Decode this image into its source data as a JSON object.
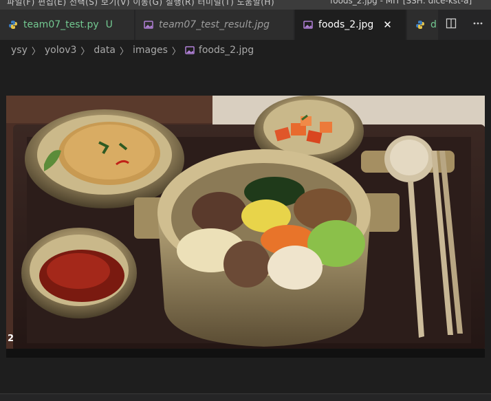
{
  "titlebar": {
    "menu": "파일(F)   편집(E)   선택(S)   보기(V)   이동(G)   실행(R)   터미널(T)   도움말(H)",
    "window_title": "foods_2.jpg - MIT [SSH: dice-kst-a]"
  },
  "tabs": [
    {
      "label": "team07_test.py",
      "status": "U",
      "icon": "python-icon"
    },
    {
      "label": "team07_test_result.jpg",
      "icon": "image-icon"
    },
    {
      "label": "foods_2.jpg",
      "icon": "image-icon",
      "active": true
    },
    {
      "label": "d",
      "icon": "python-icon"
    }
  ],
  "breadcrumb": [
    "ysy",
    "yolov3",
    "data",
    "images",
    "foods_2.jpg"
  ],
  "image": {
    "detection_label": "2",
    "description_icon": "image-icon"
  },
  "colors": {
    "accent_python": "#73c991",
    "image_icon": "#b180d7"
  }
}
